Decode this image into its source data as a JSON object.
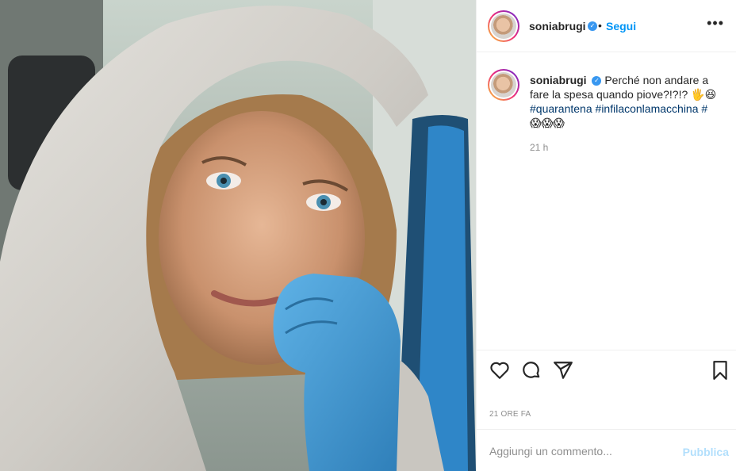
{
  "post": {
    "username": "soniabrugi",
    "follow_label": "Segui",
    "separator": "•",
    "more_label": "•••",
    "caption": {
      "username": "soniabrugi",
      "text": "Perché non andare a fare la spesa quando piove?!?!?",
      "emojis_1": "🖐😆",
      "hashtag_1": "#quarantena",
      "hashtag_2": "#infilaconlamacchina",
      "hashtag_3": "#",
      "emojis_2": "😱😱😱",
      "time": "21 h"
    },
    "timestamp": "21 ORE FA"
  },
  "comment_box": {
    "placeholder": "Aggiungi un commento...",
    "publish_label": "Pubblica"
  },
  "colors": {
    "accent": "#0095f6",
    "publish_disabled": "#b2dffc",
    "verified": "#3897f0",
    "glove": "#3a8fc9"
  },
  "icons": [
    "heart-icon",
    "comment-icon",
    "share-icon",
    "bookmark-icon",
    "verified-badge-icon",
    "more-options-icon"
  ]
}
